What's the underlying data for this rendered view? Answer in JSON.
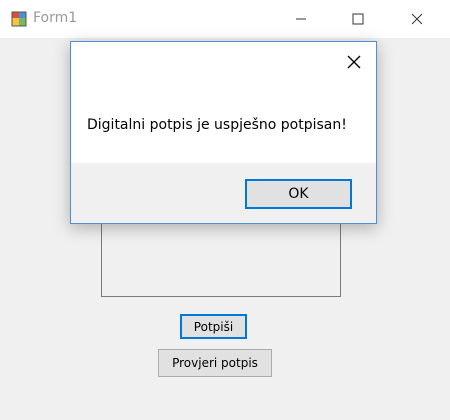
{
  "window": {
    "title": "Form1",
    "icon": "form-app-icon",
    "controls": [
      "minimize-icon",
      "maximize-icon",
      "close-icon"
    ]
  },
  "form": {
    "sign_button_label": "Potpiši",
    "verify_button_label": "Provjeri potpis"
  },
  "message_box": {
    "message": "Digitalni potpis je uspješno potpisan!",
    "ok_label": "OK",
    "close_icon": "close-icon"
  },
  "colors": {
    "accent": "#0078d7",
    "form_background": "#f0f0f0"
  }
}
